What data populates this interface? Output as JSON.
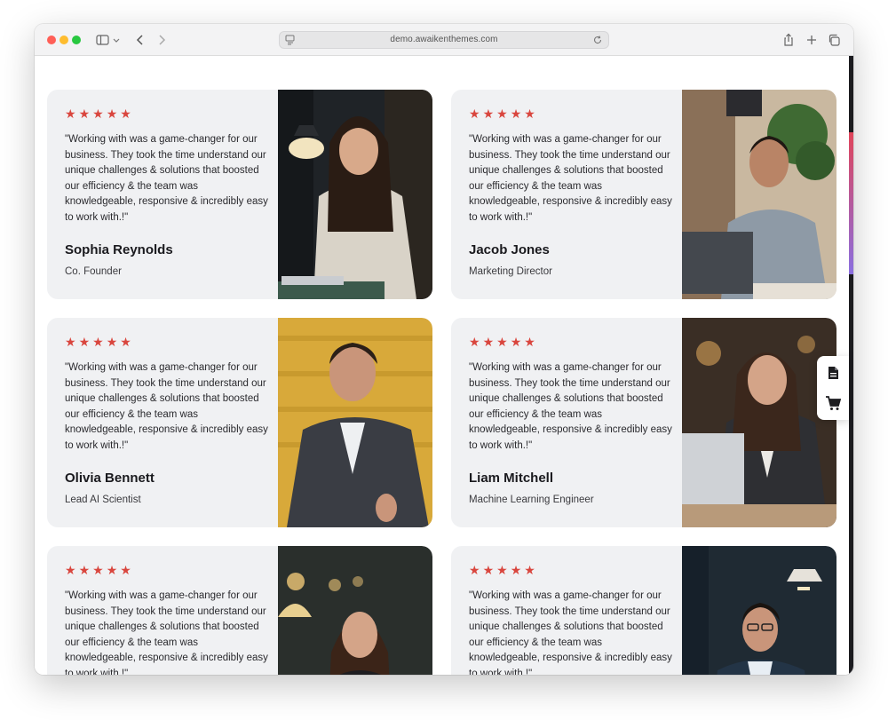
{
  "browser": {
    "url": "demo.awaikenthemes.com"
  },
  "testimonials": [
    {
      "rating": 5,
      "quote": "\"Working with was a game-changer for our business. They took the time understand our unique challenges & solutions that boosted our efficiency & the team was knowledgeable, responsive & incredibly easy to work with.!\"",
      "name": "Sophia Reynolds",
      "role": "Co. Founder"
    },
    {
      "rating": 5,
      "quote": "\"Working with was a game-changer for our business. They took the time understand our unique challenges & solutions that boosted our efficiency & the team was knowledgeable, responsive & incredibly easy to work with.!\"",
      "name": "Jacob Jones",
      "role": "Marketing Director"
    },
    {
      "rating": 5,
      "quote": "\"Working with was a game-changer for our business. They took the time understand our unique challenges & solutions that boosted our efficiency & the team was knowledgeable, responsive & incredibly easy to work with.!\"",
      "name": "Olivia Bennett",
      "role": "Lead AI Scientist"
    },
    {
      "rating": 5,
      "quote": "\"Working with was a game-changer for our business. They took the time understand our unique challenges & solutions that boosted our efficiency & the team was knowledgeable, responsive & incredibly easy to work with.!\"",
      "name": "Liam Mitchell",
      "role": "Machine Learning Engineer"
    },
    {
      "rating": 5,
      "quote": "\"Working with was a game-changer for our business. They took the time understand our unique challenges & solutions that boosted our efficiency & the team was knowledgeable, responsive & incredibly easy to work with.!\"",
      "name": "",
      "role": ""
    },
    {
      "rating": 5,
      "quote": "\"Working with was a game-changer for our business. They took the time understand our unique challenges & solutions that boosted our efficiency & the team was knowledgeable, responsive & incredibly easy to work with.!\"",
      "name": "",
      "role": ""
    }
  ],
  "side_actions": {
    "icons": [
      "document-icon",
      "cart-icon"
    ]
  },
  "colors": {
    "star": "#d9463e",
    "card_bg": "#f0f1f3",
    "text_dark": "#1a1a1e"
  }
}
